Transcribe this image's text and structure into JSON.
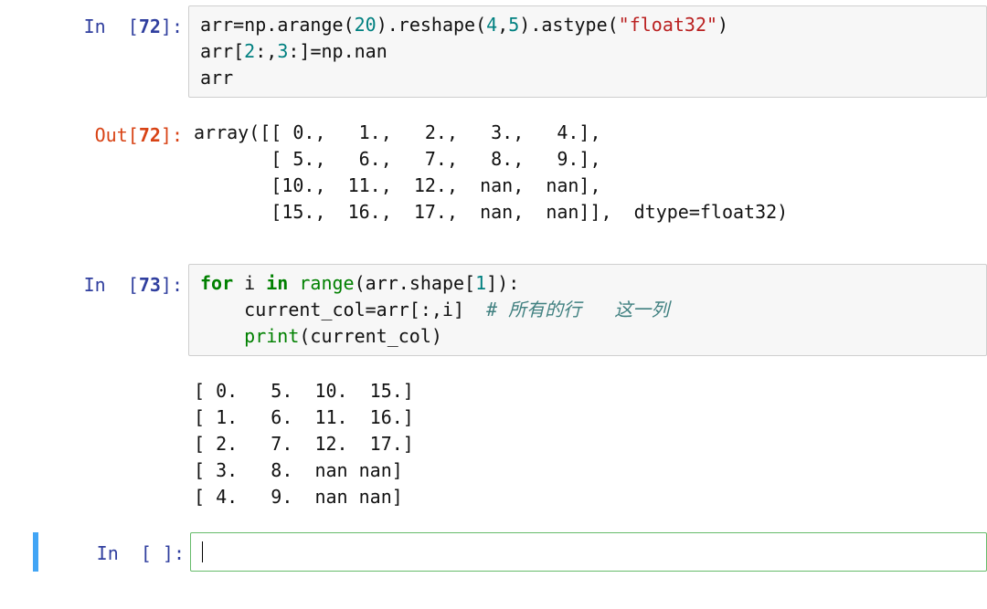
{
  "cells": {
    "c72in": {
      "prompt_in": "In  [",
      "prompt_num": "72",
      "prompt_close": "]:",
      "line1_arr": "arr",
      "line1_eq": "=",
      "line1_np": "np",
      "line1_dot1": ".",
      "line1_arange": "arange",
      "line1_p1": "(",
      "line1_n20": "20",
      "line1_p2": ").",
      "line1_reshape": "reshape",
      "line1_p3": "(",
      "line1_n4": "4",
      "line1_comma": ",",
      "line1_n5": "5",
      "line1_p4": ").",
      "line1_astype": "astype",
      "line1_p5": "(",
      "line1_str": "\"float32\"",
      "line1_p6": ")",
      "line2_arr": "arr",
      "line2_br1": "[",
      "line2_n2": "2",
      "line2_c1": ":,",
      "line2_n3": "3",
      "line2_c2": ":]",
      "line2_eq": "=",
      "line2_np": "np",
      "line2_dot": ".",
      "line2_nan": "nan",
      "line3": "arr"
    },
    "c72out": {
      "prompt_out": "Out[",
      "prompt_num": "72",
      "prompt_close": "]:",
      "text": "array([[ 0.,   1.,   2.,   3.,   4.],\n       [ 5.,   6.,   7.,   8.,   9.],\n       [10.,  11.,  12.,  nan,  nan],\n       [15.,  16.,  17.,  nan,  nan]],  dtype=float32)"
    },
    "c73in": {
      "prompt_in": "In  [",
      "prompt_num": "73",
      "prompt_close": "]:",
      "kw_for": "for",
      "l1_i": " i ",
      "kw_in": "in",
      "l1_sp": " ",
      "builtin_range": "range",
      "l1_p1": "(arr.shape[",
      "l1_n1": "1",
      "l1_p2": "]):",
      "l2_pre": "    current_col",
      "l2_eq": "=",
      "l2_arr": "arr[:,i]  ",
      "l2_comment": "# 所有的行   这一列",
      "l3_pre": "    ",
      "builtin_print": "print",
      "l3_p": "(current_col)"
    },
    "c73out": {
      "text": "[ 0.   5.  10.  15.]\n[ 1.   6.  11.  16.]\n[ 2.   7.  12.  17.]\n[ 3.   8.  nan nan]\n[ 4.   9.  nan nan]"
    },
    "newcell": {
      "prompt_in": "In  [ ]:"
    }
  }
}
